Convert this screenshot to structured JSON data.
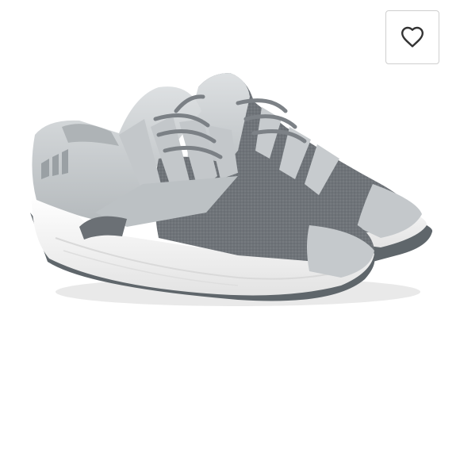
{
  "listing": {
    "image_subject": "pair-of-grey-running-shoes",
    "colors": {
      "background": "#ffffff",
      "upper_light": "#c9cdd0",
      "upper_knit": "#6d7277",
      "midsole": "#f2f2f2",
      "outsole": "#5f666b"
    }
  },
  "like_button": {
    "icon": "heart-outline-icon",
    "border_color": "#cfcfcf",
    "icon_color": "#333333"
  }
}
